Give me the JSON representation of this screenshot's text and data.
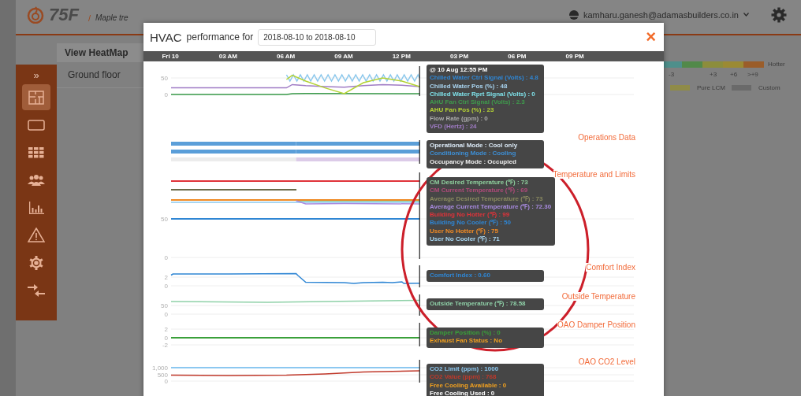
{
  "header": {
    "logo": "75F",
    "separator": "/",
    "breadcrumb": "Maple tre",
    "user": "kamharu.ganesh@adamasbuilders.co.in"
  },
  "sidebar": {
    "toggle": "»",
    "items": [
      {
        "kind": "floorplan",
        "selected": true
      },
      {
        "kind": "tablet",
        "selected": false
      },
      {
        "kind": "grid",
        "selected": false
      },
      {
        "kind": "people",
        "selected": false
      },
      {
        "kind": "barchart",
        "selected": false
      },
      {
        "kind": "warning",
        "selected": false
      },
      {
        "kind": "gear",
        "selected": false
      },
      {
        "kind": "arrows",
        "selected": false
      }
    ]
  },
  "panel": {
    "title": "View HeatMap",
    "items": [
      "Ground floor"
    ]
  },
  "legend": {
    "segments": [
      {
        "color": "#4e8f8b"
      },
      {
        "color": "#52894a"
      },
      {
        "color": "#8c8d3c"
      },
      {
        "color": "#9b8a34"
      },
      {
        "color": "#9a5d2a"
      }
    ],
    "end_label": "Hotter",
    "ticks": [
      "-3",
      "+3",
      "+6",
      ">+9"
    ],
    "keys": [
      {
        "label": "Pure LCM",
        "color": "#8f8b48"
      },
      {
        "label": "Custom",
        "color": "#6a6a6a"
      }
    ]
  },
  "modal": {
    "title": "HVAC",
    "subtitle": "performance for",
    "date_range": "2018-08-10 to 2018-08-10",
    "close": "×",
    "time_axis": [
      "Fri 10",
      "03 AM",
      "06 AM",
      "09 AM",
      "12 PM",
      "03 PM",
      "06 PM",
      "09 PM"
    ],
    "sections": [
      {
        "kind": "line",
        "y_labels": [
          "50",
          "0"
        ],
        "series": [
          {
            "color": "#a07cc5"
          },
          {
            "color": "#3a9a4a"
          },
          {
            "color": "#8cc8ec"
          },
          {
            "color": "#b5d334"
          }
        ],
        "tooltip": [
          {
            "text": "@ 10 Aug 12:55 PM",
            "color": "#ffffff"
          },
          {
            "text": "Chilled Water Ctrl Signal (Volts) : 4.8",
            "color": "#2f86d4"
          },
          {
            "text": "Chilled Water Pos (%) : 48",
            "color": "#a9d4f0"
          },
          {
            "text": "Chilled Water Rprt Signal (Volts) : 0",
            "color": "#7ee0e8"
          },
          {
            "text": "AHU Fan Ctrl Signal (Volts) : 2.3",
            "color": "#3f9a4c"
          },
          {
            "text": "AHU Fan Pos (%) : 23",
            "color": "#b5d334"
          },
          {
            "text": "Flow Rate (gpm) : 0",
            "color": "#aaaaaa"
          },
          {
            "text": "VFD (Hertz) : 24",
            "color": "#a07cc5"
          }
        ]
      },
      {
        "kind": "state_bars",
        "title": "Operations Data",
        "rows": [
          {
            "segments": [
              {
                "color": "#5b9fd9"
              },
              {
                "color": "#5b9fd8"
              }
            ]
          },
          {
            "segments": [
              {
                "color": "#5a9ed9"
              },
              {
                "color": "#5a9ed8"
              }
            ]
          },
          {
            "segments": [
              {
                "color": "#ececec"
              },
              {
                "color": "#dccbe8"
              }
            ]
          }
        ],
        "tooltip": [
          {
            "text": "Operational Mode : Cool only",
            "color": "#dbe9f6"
          },
          {
            "text": "Conditioning Mode : Cooling",
            "color": "#3d8fd6"
          },
          {
            "text": "Occupancy Mode : Occupied",
            "color": "#eeeeee"
          }
        ]
      },
      {
        "kind": "line",
        "title": "Temperature and Limits",
        "y_labels": [
          "50",
          "0"
        ],
        "series": [
          {
            "color": "#e0333a"
          },
          {
            "color": "#6b6b4a"
          },
          {
            "color": "#f08a24"
          },
          {
            "color": "#8fd19e"
          },
          {
            "color": "#a9d7f2"
          },
          {
            "color": "#a98be0"
          },
          {
            "color": "#2f86d4"
          }
        ],
        "tooltip": [
          {
            "text": "CM Desired Temperature (℉) : 73",
            "color": "#8fd19e"
          },
          {
            "text": "CM Current Temperature (℉) : 69",
            "color": "#b04a7a"
          },
          {
            "text": "Average Desired Temperature (℉) : 73",
            "color": "#8a8a60"
          },
          {
            "text": "Average Current Temperature (℉) : 72.30",
            "color": "#a98be0"
          },
          {
            "text": "Building No Hotter (℉) : 99",
            "color": "#e0333a"
          },
          {
            "text": "Building No Cooler (℉) : 50",
            "color": "#2f86d4"
          },
          {
            "text": "User No Hotter (℉) : 75",
            "color": "#f08a24"
          },
          {
            "text": "User No Cooler (℉) : 71",
            "color": "#a9d7f2"
          }
        ]
      },
      {
        "kind": "line",
        "title": "Comfort Index",
        "y_labels": [
          "2",
          "0"
        ],
        "series": [
          {
            "color": "#2f86d4"
          }
        ],
        "tooltip": [
          {
            "text": "Comfort Index : 0.60",
            "color": "#2f86d4"
          }
        ]
      },
      {
        "kind": "line",
        "title": "Outside Temperature",
        "y_labels": [
          "50",
          "0"
        ],
        "series": [
          {
            "color": "#8fd1a8"
          }
        ],
        "tooltip": [
          {
            "text": "Outside Temperature (℉) : 78.58",
            "color": "#8fd1a8"
          }
        ]
      },
      {
        "kind": "line",
        "title": "OAO Damper Position",
        "y_labels": [
          "2",
          "0",
          "-2"
        ],
        "series": [
          {
            "color": "#3aa03a"
          }
        ],
        "tooltip": [
          {
            "text": "Damper Position (%) : 0",
            "color": "#3aa03a"
          },
          {
            "text": "Exhaust Fan Status : No",
            "color": "#f0a020"
          }
        ]
      },
      {
        "kind": "line",
        "title": "OAO CO2 Level",
        "y_labels": [
          "1,000",
          "500",
          "0"
        ],
        "series": [
          {
            "color": "#8cc8f0"
          },
          {
            "color": "#c0392b"
          }
        ],
        "tooltip": [
          {
            "text": "CO2 Limit (ppm) : 1000",
            "color": "#8cc8f0"
          },
          {
            "text": "CO2 Value (ppm) : 768",
            "color": "#c0392b"
          },
          {
            "text": "Free Cooling Available : 0",
            "color": "#f0a020"
          },
          {
            "text": "Free Cooling Used : 0",
            "color": "#ffffff"
          }
        ]
      }
    ]
  },
  "annotation": {
    "kind": "ellipse"
  }
}
